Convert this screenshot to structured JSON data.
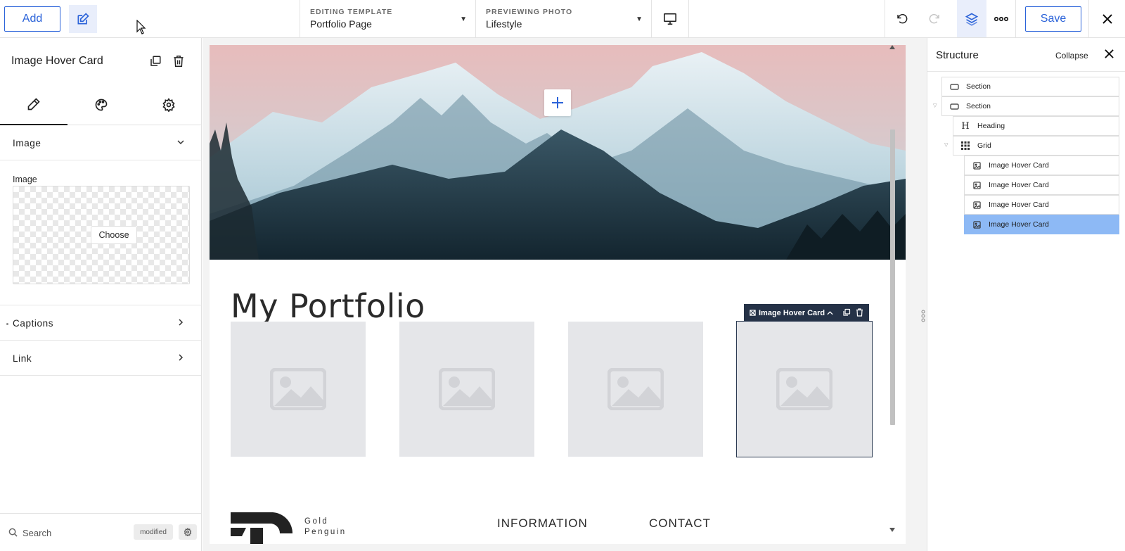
{
  "toolbar": {
    "add_label": "Add",
    "save_label": "Save",
    "editing_template": {
      "label": "EDITING TEMPLATE",
      "value": "Portfolio Page"
    },
    "previewing_photo": {
      "label": "PREVIEWING PHOTO",
      "value": "Lifestyle"
    }
  },
  "left_panel": {
    "title": "Image Hover Card",
    "sections": {
      "image": "Image",
      "image_field_label": "Image",
      "choose_label": "Choose",
      "captions": "Captions",
      "link": "Link"
    },
    "search_placeholder": "Search",
    "modified_badge": "modified"
  },
  "canvas": {
    "heading": "My Portfolio",
    "selected_toolbar_label": "Image Hover Card",
    "footer": {
      "logo_line1": "Gold",
      "logo_line2": "Penguin",
      "col1": "INFORMATION",
      "col2": "CONTACT"
    }
  },
  "structure": {
    "title": "Structure",
    "collapse_label": "Collapse",
    "nodes": [
      {
        "label": "Section",
        "icon": "section-icon"
      },
      {
        "label": "Section",
        "icon": "section-icon"
      },
      {
        "label": "Heading",
        "icon": "heading-icon"
      },
      {
        "label": "Grid",
        "icon": "grid-icon"
      },
      {
        "label": "Image Hover Card",
        "icon": "image-icon"
      },
      {
        "label": "Image Hover Card",
        "icon": "image-icon"
      },
      {
        "label": "Image Hover Card",
        "icon": "image-icon"
      },
      {
        "label": "Image Hover Card",
        "icon": "image-icon",
        "selected": true
      }
    ]
  },
  "colors": {
    "accent": "#2b63d9",
    "selected_node": "#8db9f5",
    "selection_toolbar": "#253247",
    "placeholder_card": "#e5e6e9"
  }
}
